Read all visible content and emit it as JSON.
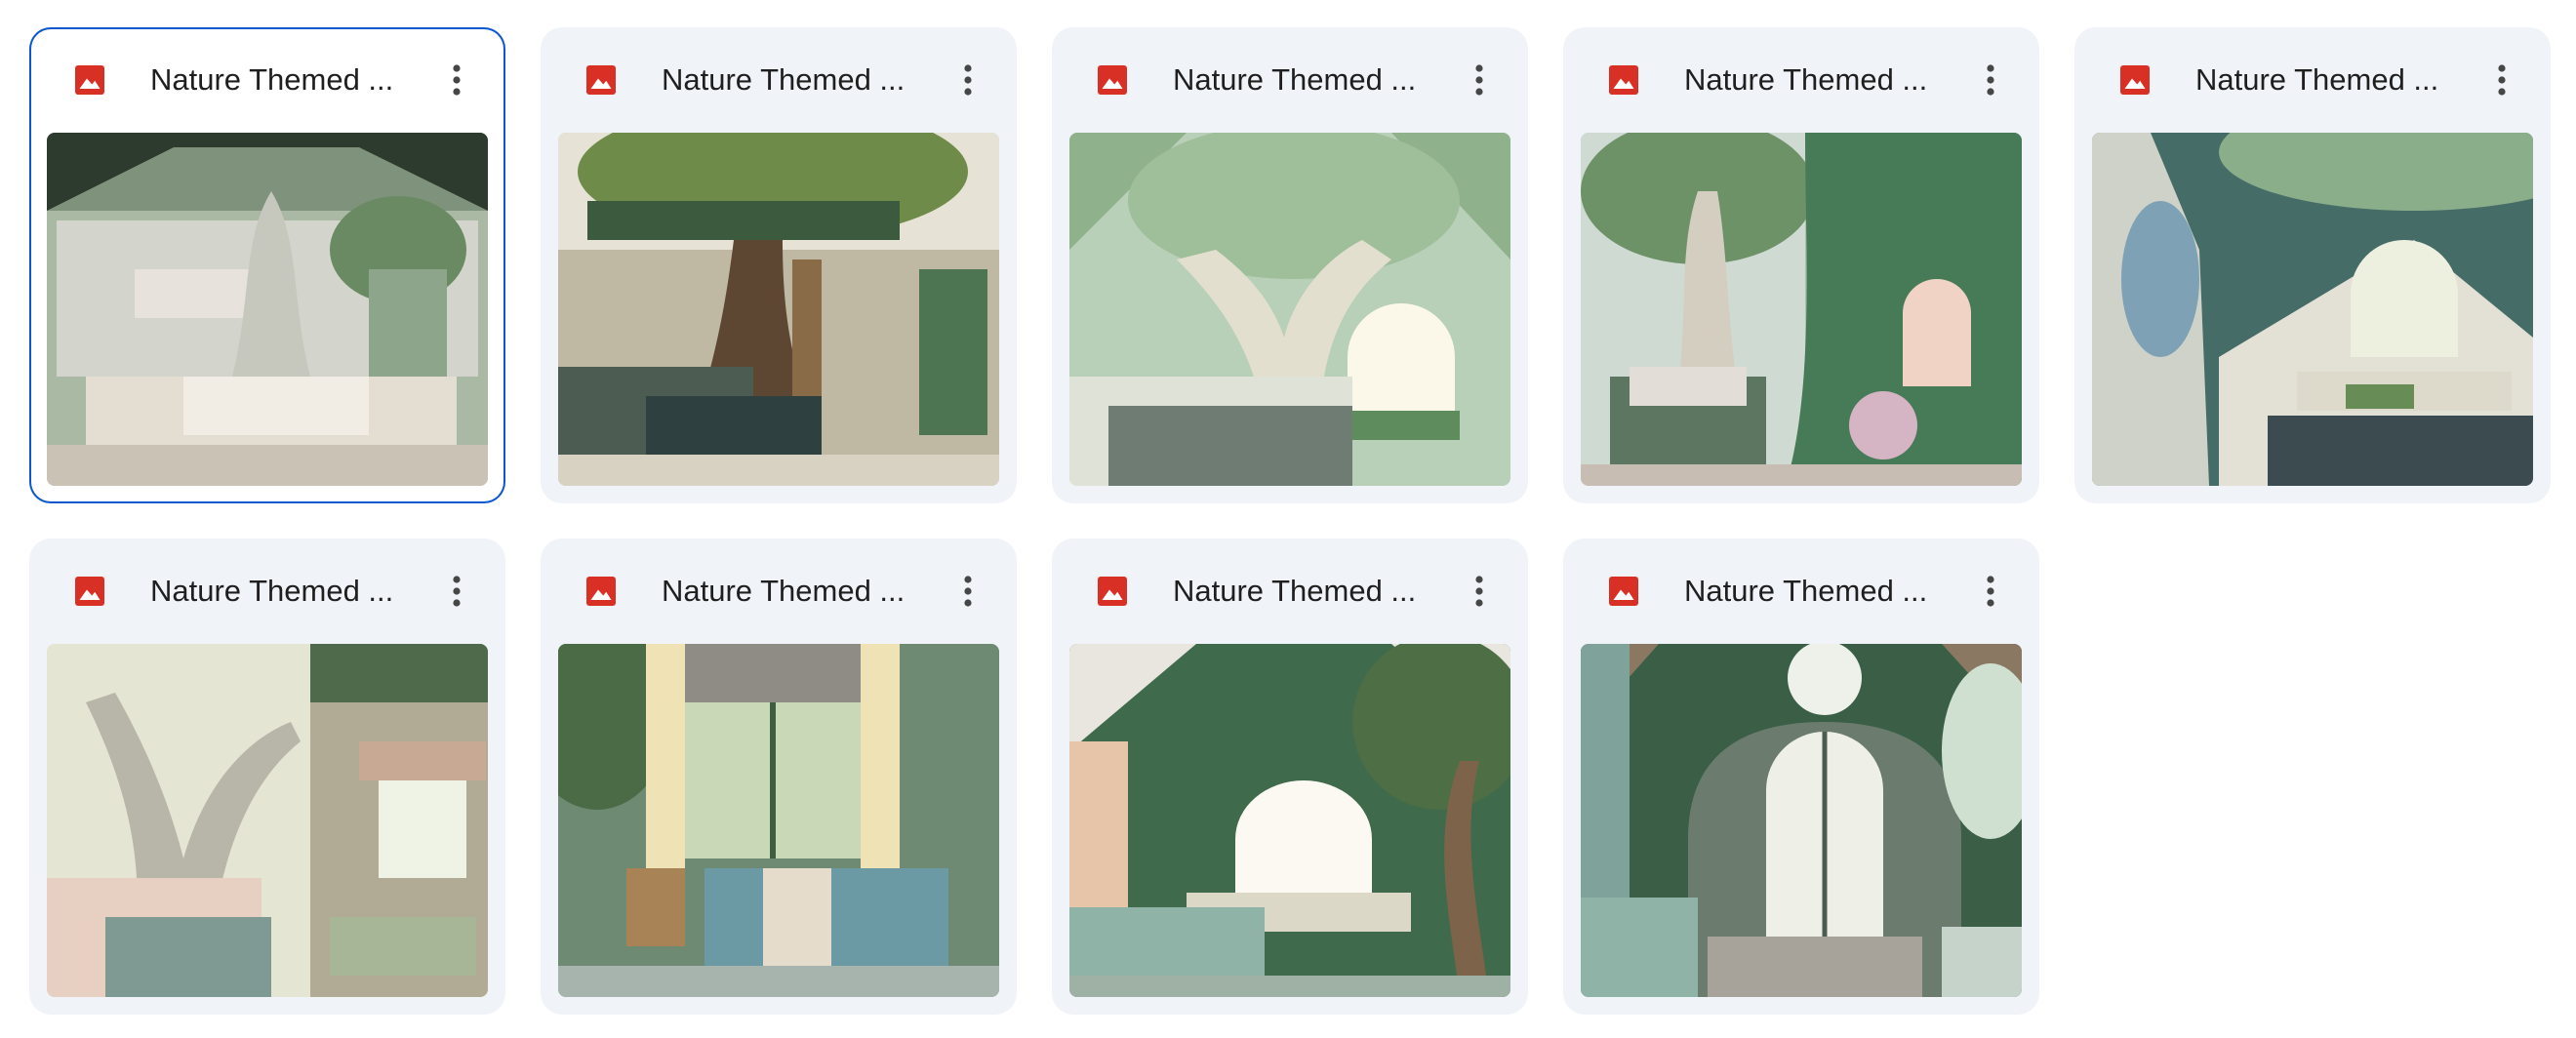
{
  "files": [
    {
      "title": "Nature Themed ...",
      "selected": true,
      "icon": "image-file-icon"
    },
    {
      "title": "Nature Themed ...",
      "selected": false,
      "icon": "image-file-icon"
    },
    {
      "title": "Nature Themed ...",
      "selected": false,
      "icon": "image-file-icon"
    },
    {
      "title": "Nature Themed ...",
      "selected": false,
      "icon": "image-file-icon"
    },
    {
      "title": "Nature Themed ...",
      "selected": false,
      "icon": "image-file-icon"
    },
    {
      "title": "Nature Themed ...",
      "selected": false,
      "icon": "image-file-icon"
    },
    {
      "title": "Nature Themed ...",
      "selected": false,
      "icon": "image-file-icon"
    },
    {
      "title": "Nature Themed ...",
      "selected": false,
      "icon": "image-file-icon"
    },
    {
      "title": "Nature Themed ...",
      "selected": false,
      "icon": "image-file-icon"
    }
  ],
  "colors": {
    "card_bg": "#f0f4f9",
    "selected_border": "#0b57d0",
    "image_icon_red": "#d93025",
    "title_text": "#1f1f1f",
    "more_icon": "#444746"
  }
}
